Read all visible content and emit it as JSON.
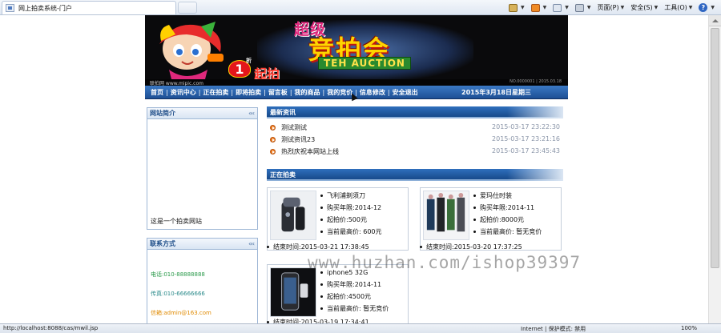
{
  "browser": {
    "tab_title": "网上拍卖系统-门户",
    "toolbar": {
      "page_label": "页面(P)",
      "safety_label": "安全(S)",
      "tools_label": "工具(O)"
    },
    "status_url": "http://localhost:8088/cas/mwil.jsp",
    "status_zone": "Internet | 保护模式: 禁用",
    "status_zoom": "100%"
  },
  "banner": {
    "super": "超级",
    "main": "竞拍会",
    "english": "TEH AUCTION",
    "one": "1",
    "zhe": "折",
    "start": "起拍",
    "site": "联拍网 www.mipic.com",
    "site_right": "NO.0000001 | 2015.03.18"
  },
  "nav": {
    "items": [
      {
        "label": "首页"
      },
      {
        "label": "资讯中心"
      },
      {
        "label": "正在拍卖"
      },
      {
        "label": "即将拍卖"
      },
      {
        "label": "留言板"
      },
      {
        "label": "我的商品"
      },
      {
        "label": "我的竞价"
      },
      {
        "label": "信息修改"
      },
      {
        "label": "安全退出"
      }
    ],
    "date": "2015年3月18日星期三"
  },
  "sidebar": {
    "intro": {
      "title": "网站简介",
      "more": "‹‹‹",
      "text": "这是一个拍卖网站"
    },
    "contact": {
      "title": "联系方式",
      "more": "‹‹‹",
      "phone": "电话:010-88888888",
      "fax": "传真:010-66666666",
      "email": "信箱:admin@163.com"
    }
  },
  "news": {
    "title": "最新资讯",
    "items": [
      {
        "title": "测试测试",
        "time": "2015-03-17 23:22:30"
      },
      {
        "title": "测试资讯23",
        "time": "2015-03-17 23:21:16"
      },
      {
        "title": "热烈庆祝本网站上线",
        "time": "2015-03-17 23:45:43"
      }
    ]
  },
  "auctions": {
    "title": "正在拍卖",
    "cards": [
      {
        "name": "飞利浦剃须刀",
        "period": "购买年限:2014-12",
        "start_price": "起拍价:500元",
        "current_price": "当前最高价: 600元",
        "end_time": "结束时间:2015-03-21  17:38:45"
      },
      {
        "name": "爱玛仕时装",
        "period": "购买年限:2014-11",
        "start_price": "起拍价:8000元",
        "current_price": "当前最高价: 暂无竞价",
        "end_time": "结束时间:2015-03-20  17:37:25"
      },
      {
        "name": "iphone5 32G",
        "period": "购买年限:2014-11",
        "start_price": "起拍价:4500元",
        "current_price": "当前最高价: 暂无竞价",
        "end_time": "结束时间:2015-03-19  17:34:41"
      }
    ]
  },
  "watermark": "www.huzhan.com/ishop39397",
  "colors": {
    "nav_blue": "#1d4f94",
    "phone": "#2a9a4a",
    "fax": "#2a8a8a",
    "email": "#e08a00"
  }
}
